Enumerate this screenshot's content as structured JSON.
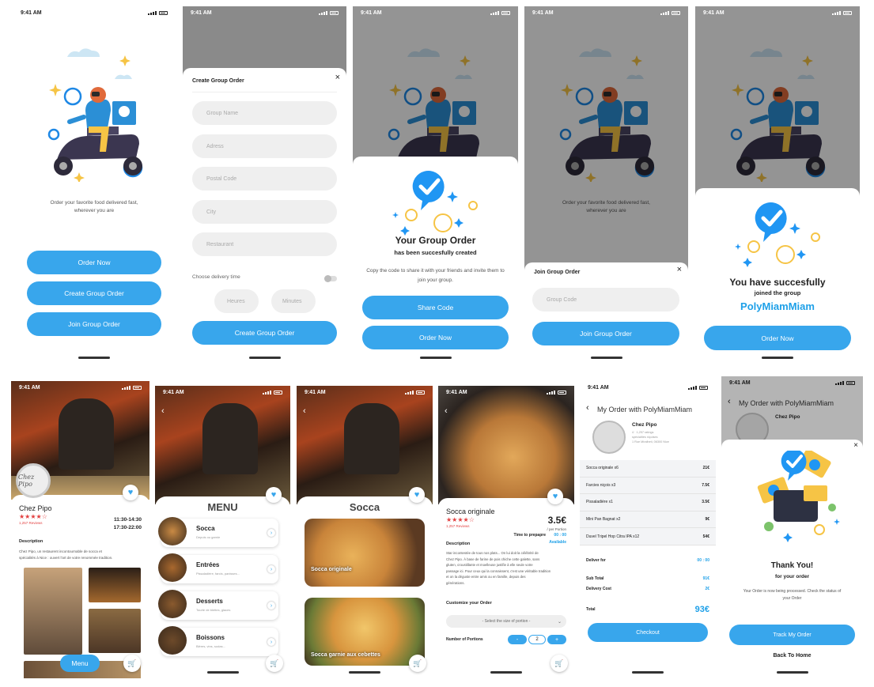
{
  "status_time": "9:41 AM",
  "colors": {
    "primary": "#38a6ec",
    "accent": "#1ea0e8",
    "star": "#e23f3f"
  },
  "welcome": {
    "tagline1": "Order your favorite food delivered fast,",
    "tagline2": "wherever you are",
    "order_now": "Order Now",
    "create_group": "Create Group Order",
    "join_group": "Join Group Order"
  },
  "create_form": {
    "title": "Create Group Order",
    "group_name": "Group Name",
    "adress": "Adress",
    "postal_code": "Postal Code",
    "city": "City",
    "restaurant": "Restaurant",
    "delivery_time": "Choose delivery time",
    "hours": "Heures",
    "minutes": "Minutes",
    "submit": "Create Group Order"
  },
  "group_created": {
    "title": "Your Group Order",
    "subtitle": "has been succesfully created",
    "body": "Copy the code to share it with your friends and invite them to join your group.",
    "share": "Share Code",
    "order_now": "Order Now"
  },
  "join_sheet": {
    "tagline1": "Order your favorite food delivered fast,",
    "tagline2": "wherever you are",
    "title": "Join Group Order",
    "code_placeholder": "Group Code",
    "submit": "Join Group Order"
  },
  "joined": {
    "line1": "You have succesfully",
    "line2": "joined the group",
    "group": "PolyMiamMiam",
    "order_now": "Order Now"
  },
  "restaurant": {
    "name": "Chez Pipo",
    "reviews": "1,257 Reviews",
    "hours1": "11:30-14:30",
    "hours2": "17:30-22:00",
    "desc_title": "Description",
    "desc_line1": "Chez Pipo, un restaurent incontournable de socca et",
    "desc_line2": "spécialités à Nice : ouvert l'art de votre renommée tradition.",
    "menu_btn": "Menu",
    "logo_text": "Chez Pipo"
  },
  "menu": {
    "title": "MENU",
    "items": [
      {
        "name": "Socca",
        "sub": "Depuis ou garnie"
      },
      {
        "name": "Entrées",
        "sub": "Pissaladière, farcis, panisses..."
      },
      {
        "name": "Desserts",
        "sub": "Tourte de blettes, glaces"
      },
      {
        "name": "Boissons",
        "sub": "Bières, vins, sodas..."
      }
    ]
  },
  "socca": {
    "title": "Socca",
    "items": [
      "Socca originale",
      "Socca garnie aux cebettes"
    ]
  },
  "product": {
    "name": "Socca originale",
    "reviews": "1,257 Reviews",
    "price": "3.5€",
    "per": "/ per Portion",
    "time_label": "Time to prepapre",
    "time_value": "00 : 00",
    "available": "Available",
    "desc_title": "Description",
    "desc_lines": [
      "Star incontestée de tous nos plats... On lui doit la célébrité de",
      "Chez Pipo. À base de farine de pois chiche cette galette, sans",
      "gluten, croustillante et moelleuse justifie à elle seule votre",
      "passage ici. Pour ceux qui la connaissent, c'est une véritable tradition",
      "et on la déguste entre amis ou en famille, depuis des",
      "générations."
    ],
    "customize": "Customize your Order",
    "select": "- Select the size of portion -",
    "portions": "Number of Portions",
    "qty": "2",
    "minus": "-",
    "plus": "+"
  },
  "my_order": {
    "title": "My Order with PolyMiamMiam",
    "resto": "Chez Pipo",
    "info1": "4 · 1,257 ratings",
    "info2": "spécialités niçoises",
    "info3": "1 Rue Miralheti, 06300 Nice",
    "lines": [
      {
        "item": "Socca originale x6",
        "price": "21€"
      },
      {
        "item": "Farcies niçois x3",
        "price": "7.5€"
      },
      {
        "item": "Pissaladière x1",
        "price": "3.5€"
      },
      {
        "item": "Mini Pan Bagnat x2",
        "price": "9€"
      },
      {
        "item": "Duvel Tripel Hop Citra IPA x12",
        "price": "54€"
      }
    ],
    "deliver_for": "Deliver for",
    "deliver_time": "00 : 00",
    "subtotal_label": "Sub Total",
    "subtotal": "91€",
    "delivery_label": "Delivery Cost",
    "delivery": "2€",
    "total_label": "Total",
    "total": "93€",
    "checkout": "Checkout"
  },
  "thanks": {
    "back_title": "My Order with PolyMiamMiam",
    "resto": "Chez Pipo",
    "title": "Thank You!",
    "sub": "for your order",
    "body1": "Your Order is now being processed. Check the status of",
    "body2": "your Order",
    "track": "Track My Order",
    "home": "Back To Home"
  }
}
